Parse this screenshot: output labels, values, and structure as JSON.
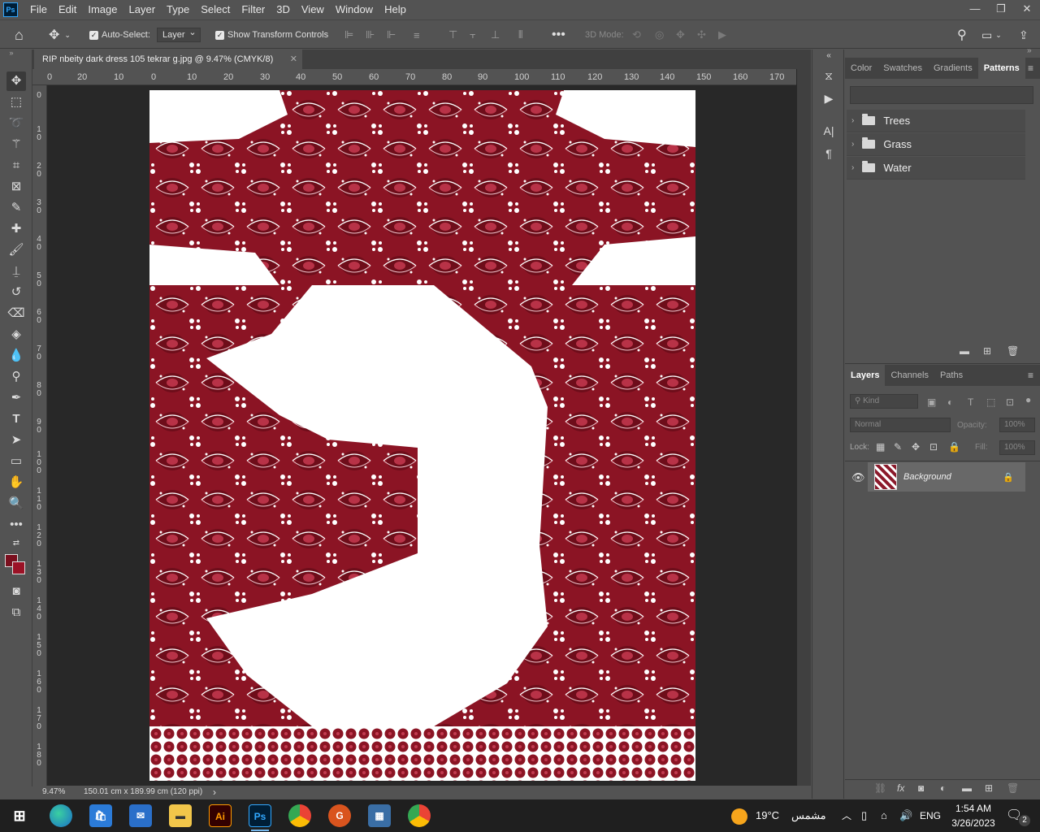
{
  "app": {
    "logo": "Ps",
    "menu": [
      "File",
      "Edit",
      "Image",
      "Layer",
      "Type",
      "Select",
      "Filter",
      "3D",
      "View",
      "Window",
      "Help"
    ],
    "window_controls": [
      "—",
      "❐",
      "✕"
    ]
  },
  "options_bar": {
    "auto_select_label": "Auto-Select:",
    "auto_select_value": "Layer",
    "show_transform_label": "Show Transform Controls",
    "mode_3d_label": "3D Mode:"
  },
  "document": {
    "tab_title": "RIP nbeity  dark dress 105 tekrar g.jpg @ 9.47% (CMYK/8)",
    "close_glyph": "✕",
    "pattern_colors": {
      "dark": "#7a0f1e",
      "mid": "#9b1226",
      "light": "#ffffff"
    }
  },
  "rulers": {
    "top": [
      "0",
      "20",
      "10",
      "0",
      "10",
      "20",
      "30",
      "40",
      "50",
      "60",
      "70",
      "80",
      "90",
      "100",
      "110",
      "120",
      "130",
      "140",
      "150",
      "160",
      "170"
    ],
    "left": [
      "0",
      "1 0",
      "2 0",
      "3 0",
      "4 0",
      "5 0",
      "6 0",
      "7 0",
      "8 0",
      "9 0",
      "1 0 0",
      "1 1 0",
      "1 2 0",
      "1 3 0",
      "1 4 0",
      "1 5 0",
      "1 6 0",
      "1 7 0",
      "1 8 0"
    ]
  },
  "status_bar": {
    "zoom": "9.47%",
    "doc_info": "150.01 cm x 189.99 cm (120 ppi)",
    "arrow": "›"
  },
  "patterns_panel": {
    "tabs": [
      "Color",
      "Swatches",
      "Gradients",
      "Patterns"
    ],
    "active_tab": "Patterns",
    "folders": [
      "Trees",
      "Grass",
      "Water"
    ]
  },
  "layers_panel": {
    "tabs": [
      "Layers",
      "Channels",
      "Paths"
    ],
    "active_tab": "Layers",
    "kind_placeholder": "Kind",
    "blend_mode": "Normal",
    "opacity_label": "Opacity:",
    "opacity_value": "100%",
    "lock_label": "Lock:",
    "fill_label": "Fill:",
    "fill_value": "100%",
    "layers": [
      {
        "name": "Background",
        "visible": true,
        "locked": true
      }
    ]
  },
  "taskbar": {
    "apps": [
      "windows",
      "edge",
      "store",
      "mail",
      "explorer",
      "illustrator",
      "photoshop",
      "chrome",
      "grammarly",
      "calculator",
      "chrome-profile"
    ],
    "illustrator_label": "Ai",
    "photoshop_label": "Ps",
    "weather_temp": "19°C",
    "weather_text": "مشمس",
    "language": "ENG",
    "time": "1:54 AM",
    "date": "3/26/2023",
    "notification_count": "2"
  }
}
